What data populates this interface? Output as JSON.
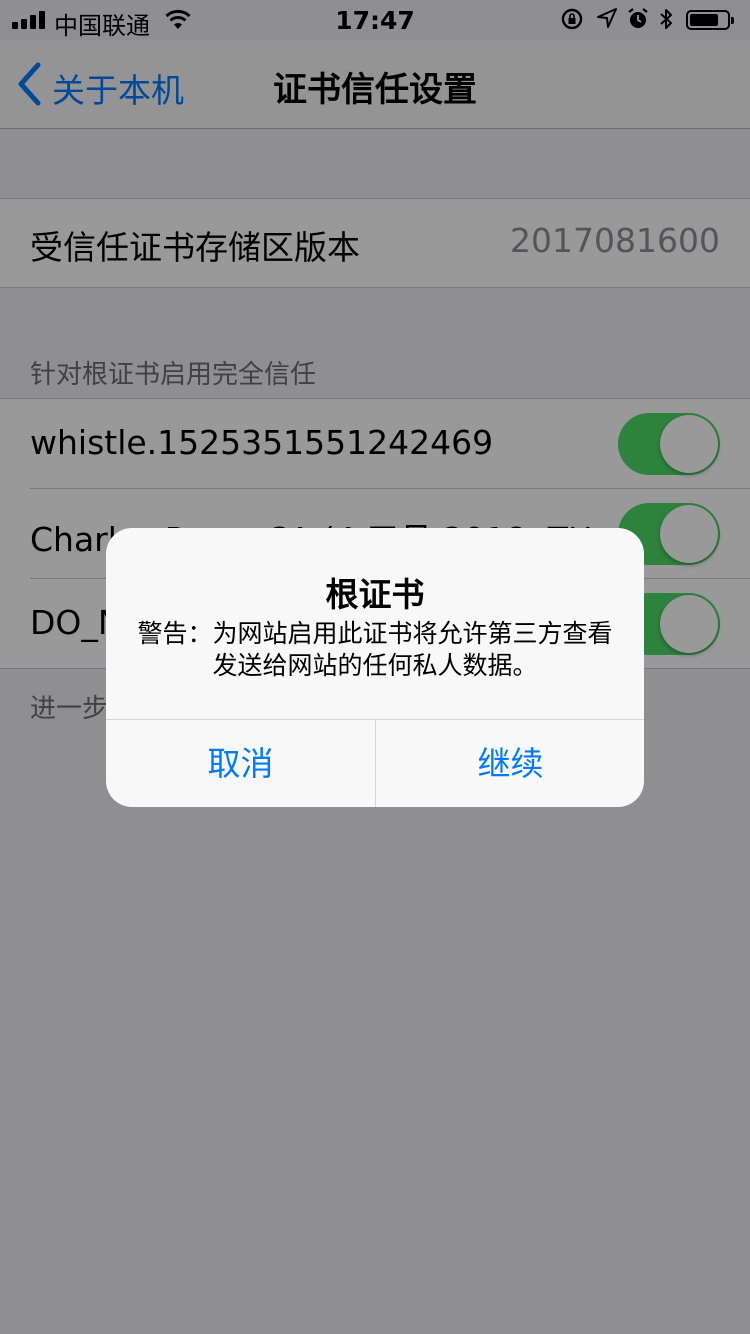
{
  "status_bar": {
    "carrier": "中国联通",
    "time": "17:47",
    "icons": [
      "signal-icon",
      "wifi-icon",
      "rotation-lock-icon",
      "location-icon",
      "alarm-icon",
      "bluetooth-icon",
      "battery-icon"
    ]
  },
  "nav": {
    "back_label": "关于本机",
    "title": "证书信任设置"
  },
  "store_version": {
    "label": "受信任证书存储区版本",
    "value": "2017081600"
  },
  "full_trust": {
    "header": "针对根证书启用完全信任",
    "items": [
      {
        "label": "whistle.1525351551242469",
        "enabled": true
      },
      {
        "label": "Charles Proxy CA (4 五月 2018, THO",
        "enabled": true
      },
      {
        "label": "DO_NOT_TRUST_FiddlerRoot",
        "enabled": true
      }
    ],
    "footer": "进一步了解受信任的证书"
  },
  "alert": {
    "title": "根证书",
    "message": "警告：为网站启用此证书将允许第三方查看发送给网站的任何私人数据。",
    "cancel_label": "取消",
    "continue_label": "继续"
  },
  "colors": {
    "accent": "#007aff",
    "toggle_on": "#4cd964"
  }
}
